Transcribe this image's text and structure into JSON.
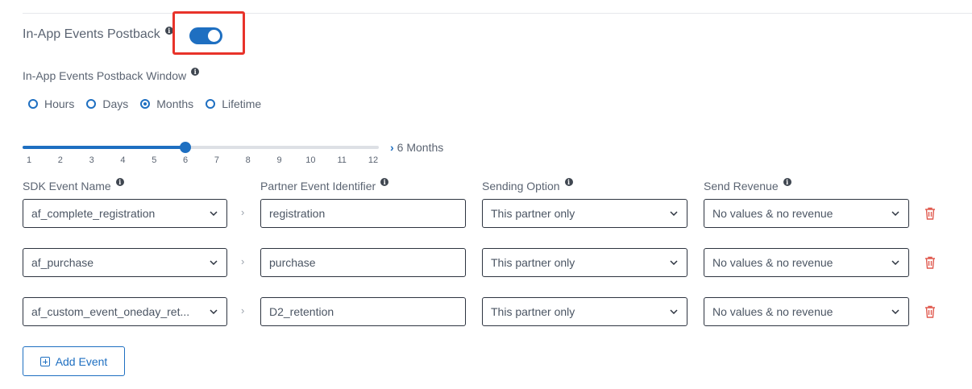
{
  "postback": {
    "label": "In-App Events Postback",
    "enabled": true
  },
  "window": {
    "label": "In-App Events Postback Window",
    "options": [
      "Hours",
      "Days",
      "Months",
      "Lifetime"
    ],
    "selected": "Months",
    "slider_value": 6,
    "slider_max": 12,
    "value_label": "6 Months",
    "ticks": [
      "1",
      "2",
      "3",
      "4",
      "5",
      "6",
      "7",
      "8",
      "9",
      "10",
      "11",
      "12"
    ]
  },
  "columns": {
    "sdk_event": "SDK Event Name",
    "partner_event": "Partner Event Identifier",
    "sending_option": "Sending Option",
    "send_revenue": "Send Revenue"
  },
  "events": [
    {
      "sdk": "af_complete_registration",
      "partner": "registration",
      "sending": "This partner only",
      "revenue": "No values & no revenue"
    },
    {
      "sdk": "af_purchase",
      "partner": "purchase",
      "sending": "This partner only",
      "revenue": "No values & no revenue"
    },
    {
      "sdk": "af_custom_event_oneday_ret...",
      "partner": "D2_retention",
      "sending": "This partner only",
      "revenue": "No values & no revenue"
    }
  ],
  "add_event_label": "Add Event",
  "colors": {
    "accent": "#1e6fc1",
    "highlight": "#e8332a",
    "delete": "#e05a4f"
  },
  "icons": {
    "info": "info-icon",
    "caret": "chevron-down-icon",
    "arrow": "chevron-right-icon",
    "delete": "trash-icon",
    "add": "plus-square-icon"
  }
}
